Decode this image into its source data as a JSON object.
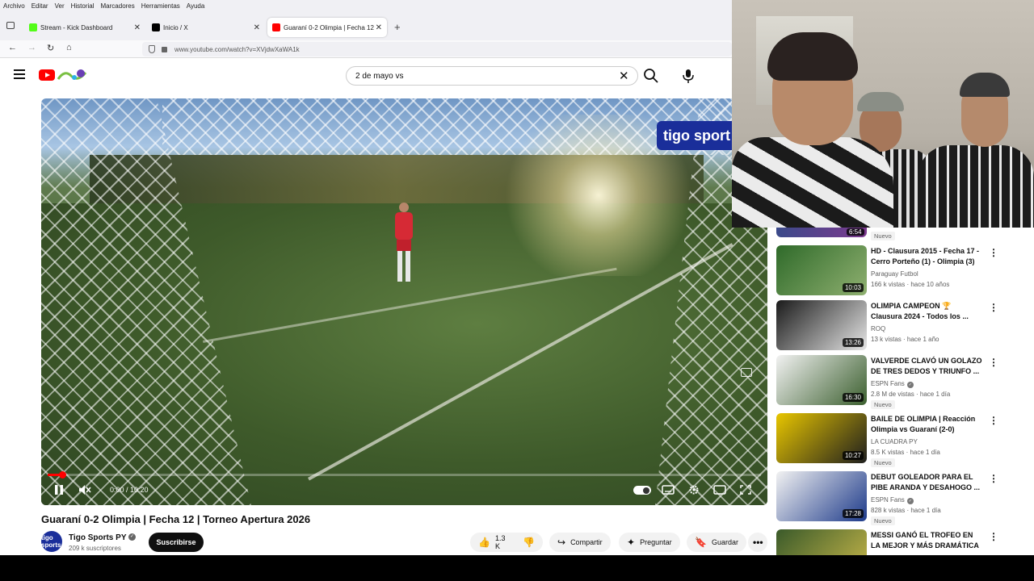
{
  "menubar": [
    "Archivo",
    "Editar",
    "Ver",
    "Historial",
    "Marcadores",
    "Herramientas",
    "Ayuda"
  ],
  "tabs": [
    {
      "label": "Stream - Kick Dashboard",
      "color": "#53fc18"
    },
    {
      "label": "Inicio / X",
      "color": "#000000"
    },
    {
      "label": "Guaraní 0-2 Olimpia | Fecha 12",
      "color": "#ff0000"
    }
  ],
  "browser": {
    "url": "www.youtube.com/watch?v=XVjdwXaWA1k",
    "new_tab": "+"
  },
  "search": {
    "query": "2 de mayo vs",
    "clear": "✕"
  },
  "player": {
    "overlay_badge": "tigo sport",
    "time": "0:00 / 10:20",
    "progress": 0.003,
    "accent": "#ff0000"
  },
  "video": {
    "title": "Guaraní 0-2 Olimpia | Fecha 12 | Torneo Apertura 2026",
    "channel": "Tigo Sports PY",
    "avatar_text": "tigo sports",
    "subscribers": "209 k suscriptores",
    "subscribe": "Suscribirse",
    "likes": "1.3 K",
    "share": "Compartir",
    "ask": "Preguntar",
    "save": "Guardar"
  },
  "partial_item": {
    "duration": "6:54",
    "badge": "Nuevo"
  },
  "recommendations": [
    {
      "title": "HD - Clausura 2015 - Fecha 17 - Cerro Porteño (1) - Olimpia (3)",
      "channel": "Paraguay Futbol",
      "meta": "166 k vistas · hace 10 años",
      "duration": "10:03",
      "badge": "",
      "verified": false,
      "thumb_a": "#2f6a2a",
      "thumb_b": "#8fb070"
    },
    {
      "title": "OLIMPIA CAMPEON 🏆 Clausura 2024 - Todos los ...",
      "channel": "ROQ",
      "meta": "13 k vistas · hace 1 año",
      "duration": "13:26",
      "badge": "",
      "verified": false,
      "thumb_a": "#1a1a1a",
      "thumb_b": "#e6e6e6"
    },
    {
      "title": "VALVERDE CLAVÓ UN GOLAZO DE TRES DEDOS Y TRIUNFO ...",
      "channel": "ESPN Fans",
      "meta": "2.8 M de vistas · hace 1 día",
      "duration": "16:30",
      "badge": "Nuevo",
      "verified": true,
      "thumb_a": "#f2f2f2",
      "thumb_b": "#3b5f2e"
    },
    {
      "title": "BAILE DE OLIMPIA | Reacción Olimpia vs Guaraní (2-0)",
      "channel": "LA CUADRA PY",
      "meta": "8.5 K vistas · hace 1 día",
      "duration": "10:27",
      "badge": "Nuevo",
      "verified": false,
      "thumb_a": "#e8c600",
      "thumb_b": "#1e1e1e"
    },
    {
      "title": "DEBUT GOLEADOR PARA EL PIBE ARANDA Y DESAHOGO ...",
      "channel": "ESPN Fans",
      "meta": "828 k vistas · hace 1 día",
      "duration": "17:28",
      "badge": "Nuevo",
      "verified": true,
      "thumb_a": "#f2f2f2",
      "thumb_b": "#1d3a8a"
    },
    {
      "title": "MESSI GANÓ EL TROFEO EN LA MEJOR Y MÁS DRAMÁTICA ...",
      "channel": "",
      "meta": "",
      "duration": "",
      "badge": "",
      "verified": false,
      "thumb_a": "#3a5a2a",
      "thumb_b": "#c9b84a"
    }
  ]
}
